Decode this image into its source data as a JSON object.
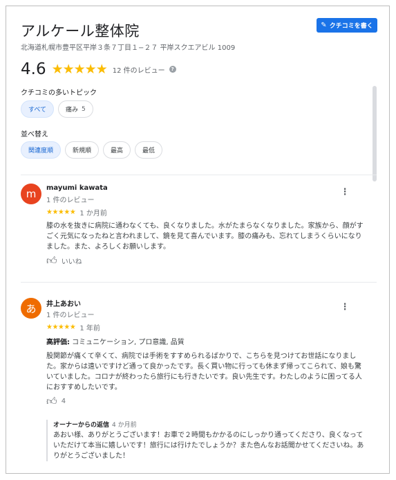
{
  "place": {
    "name": "アルケール整体院",
    "address": "北海道札幌市豊平区平岸３条７丁目１−２７ 平岸スクエアビル 1009",
    "rating": "4.6",
    "stars": "★★★★★",
    "review_count": "12 件のレビュー",
    "help_icon": "?"
  },
  "write_review_button": {
    "label": "クチコミを書く",
    "icon": "pencil-icon"
  },
  "topics": {
    "label": "クチコミの多いトピック",
    "chips": [
      {
        "label": "すべて",
        "count": "",
        "active": true
      },
      {
        "label": "痛み",
        "count": "5",
        "active": false
      }
    ]
  },
  "sort": {
    "label": "並べ替え",
    "chips": [
      {
        "label": "関連度順",
        "active": true
      },
      {
        "label": "新規順",
        "active": false
      },
      {
        "label": "最高",
        "active": false
      },
      {
        "label": "最低",
        "active": false
      }
    ]
  },
  "reviews": [
    {
      "avatar_letter": "m",
      "avatar_color": "#e8431f",
      "name": "mayumi kawata",
      "sub": "1 件のレビュー",
      "stars": "★★★★★",
      "time": "1 か月前",
      "text": "膝の水を抜きに病院に通わなくても、良くなりました。水がたまらなくなりました。家族から、顔がすごく元気になったねと言われまして、鏡を見て喜んでいます。膝の痛みも、忘れてしまうくらいになりました。また、よろしくお願いします。",
      "like_label": "いいね",
      "more": "⋮"
    },
    {
      "avatar_letter": "あ",
      "avatar_color": "#ef6c00",
      "name": "井上あおい",
      "sub": "1 件のレビュー",
      "stars": "★★★★★",
      "time": "1 年前",
      "attr_key": "高評価:",
      "attr_value": " コミュニケーション, プロ意識, 品質",
      "text": "股関節が痛くて辛くて、病院では手術をすすめられるばかりで、こちらを見つけてお世話になりました。家からは遠いですけど通って良かったです。長く買い物に行っても休まず帰ってこられて、娘も驚いていました。コロナが終わったら旅行にも行きたいです。良い先生です。わたしのように困ってる人におすすめしたいです。",
      "like_label": "4",
      "more": "⋮",
      "owner_reply": {
        "title": "オーナーからの返信",
        "time": "4 か月前",
        "text": "あおい様、ありがとうございます！お車で２時間もかかるのにしっかり通ってくださり、良くなっていただけて本当に嬉しいです！旅行には行けたでしょうか？また色んなお話聞かせてくださいね。ありがとうございました！"
      }
    }
  ]
}
